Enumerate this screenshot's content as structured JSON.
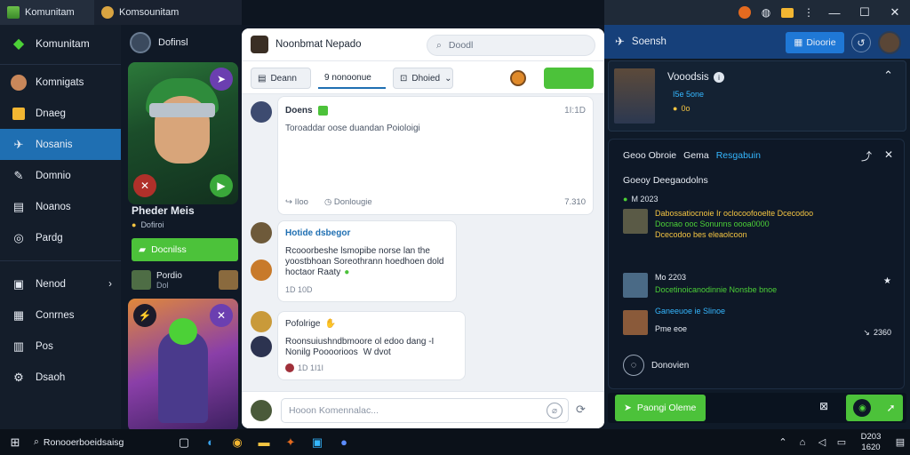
{
  "window_tabs": [
    {
      "label": "Komunitam"
    },
    {
      "label": "Komsounitam"
    }
  ],
  "topbar_icons": [
    "shield-icon",
    "globe-icon",
    "folder-icon",
    "more-icon"
  ],
  "sidebar": {
    "brand": "Komunitam",
    "items": [
      {
        "label": "Komnigats",
        "icon": "avatar"
      },
      {
        "label": "Dnaeg",
        "icon": "shop-icon"
      },
      {
        "label": "Nosanis",
        "icon": "bird-icon",
        "active": true
      },
      {
        "label": "Domnio",
        "icon": "wrench-icon"
      },
      {
        "label": "Noanos",
        "icon": "calendar-icon"
      },
      {
        "label": "Pardg",
        "icon": "globe-icon"
      },
      {
        "label": "Nenod",
        "icon": "monitor-icon",
        "chevron": true
      },
      {
        "label": "Conrnes",
        "icon": "grid-icon"
      },
      {
        "label": "Pos",
        "icon": "book-icon"
      },
      {
        "label": "Dsaoh",
        "icon": "gear-icon"
      }
    ]
  },
  "game_column": {
    "header": "Dofinsl",
    "hero_title": "Pheder Meis",
    "hero_sub": "Dofiroi",
    "green_button": "Docnilss",
    "player_name": "Pordio",
    "player_sub": "Dol"
  },
  "chat": {
    "title": "Noonbmat Nepado",
    "search_placeholder": "Doodl",
    "toolbar": {
      "btn1": "Deann",
      "tab_active": "9 nonoonue",
      "dropdown": "Dhoied",
      "green_btn": ""
    },
    "messages": [
      {
        "name": "Doens",
        "time": "1I:1D",
        "text": "Toroaddar oose duandan Poioloigi",
        "footer_left": "Iloo",
        "footer_mid": "Donlougie",
        "footer_right": "7.310"
      },
      {
        "name": "Hotide dsbegor",
        "lines": [
          "Rcooorbeshe lsmopibe norse lan the",
          "yoostbhoan Soreothrann hoedhoen dold",
          "hoctaor Raaty"
        ],
        "time": "1D 10D"
      },
      {
        "name": "Pofolrige",
        "lines": [
          "Roonsuiushndbmoore ol edoo dang -I",
          "Nonilg Poooorioos"
        ],
        "badges": "W dvot",
        "time": "1D 1I1I"
      }
    ],
    "composer_placeholder": "Hooon Komennalac..."
  },
  "right_panel": {
    "tab_label": "Soensh",
    "button": "Dioorie",
    "profile": {
      "name": "Vooodsis",
      "line1": "I5e 5one",
      "line2": "0o"
    },
    "detail_header": {
      "a": "Geoo Obroie",
      "b": "Gema",
      "c": "Resgabuin"
    },
    "section_title": "Goeoy Deegaodolns",
    "feed": [
      {
        "id": "M 2023",
        "line1": "Dabossatiocnoie Ir oclocoofooelte Dcecodoo",
        "line2": "Docnao ooc Sonunns oooa0000",
        "line3": "Dcecodoo bes eleaolcoon"
      },
      {
        "id": "Mo 2203",
        "line1": "Docetinoicanodinnie Nonsbe bnoe"
      },
      {
        "id": "",
        "line1": "Ganeeuoe ie Slinoe",
        "line2": "Pme eoe",
        "time": "2360"
      },
      {
        "id": "",
        "line1": "Donovien"
      }
    ],
    "bottom_button": "Paongi Oleme"
  },
  "taskbar": {
    "search_label": "Ronooerboeidsaisg",
    "time": "D203",
    "date": "1620"
  },
  "colors": {
    "accent": "#1f6fb2",
    "green": "#4cd137",
    "cyan": "#35b7ff"
  }
}
